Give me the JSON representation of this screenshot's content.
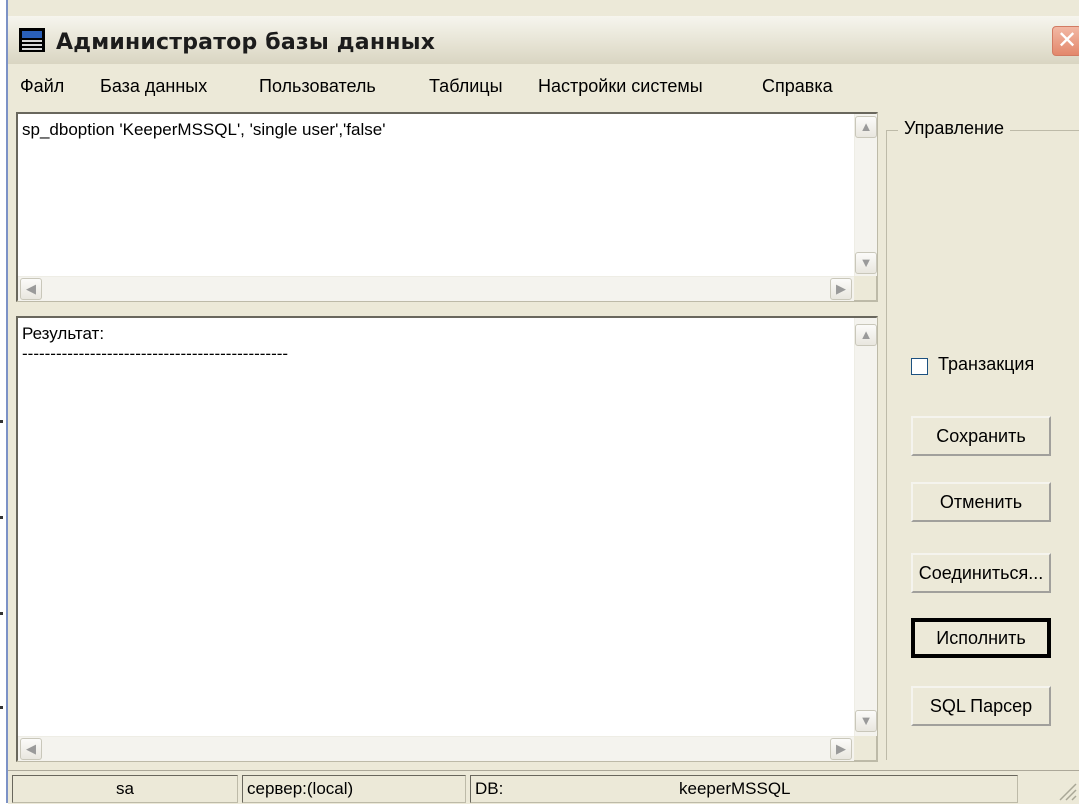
{
  "window": {
    "title": "Администратор базы данных",
    "close_glyph": "✕"
  },
  "menu": {
    "items": [
      "Файл",
      "База данных",
      "Пользователь",
      "Таблицы",
      "Настройки системы",
      "Справка"
    ]
  },
  "query": {
    "text": "sp_dboption 'KeeperMSSQL', 'single user','false'"
  },
  "result": {
    "label": "Результат:",
    "separator": "-----------------------------------------------"
  },
  "control": {
    "group_title": "Управление",
    "transaction_label": "Транзакция",
    "transaction_checked": false,
    "buttons": {
      "save": "Сохранить",
      "cancel": "Отменить",
      "connect": "Соединиться...",
      "execute": "Исполнить",
      "parser": "SQL Парсер"
    }
  },
  "status": {
    "user": "sa",
    "server": "сервер:(local)",
    "db_label": "DB:",
    "db_name": "keeperMSSQL"
  },
  "icons": {
    "scroll_up": "scroll-up-arrow-icon",
    "scroll_down": "scroll-down-arrow-icon",
    "scroll_left": "scroll-left-arrow-icon",
    "scroll_right": "scroll-right-arrow-icon",
    "app": "app-window-icon",
    "close": "close-icon",
    "grip": "resize-grip-icon"
  },
  "colors": {
    "face": "#ece9d8",
    "close_button": "#e3886c",
    "window_border": "#7c92c6"
  }
}
